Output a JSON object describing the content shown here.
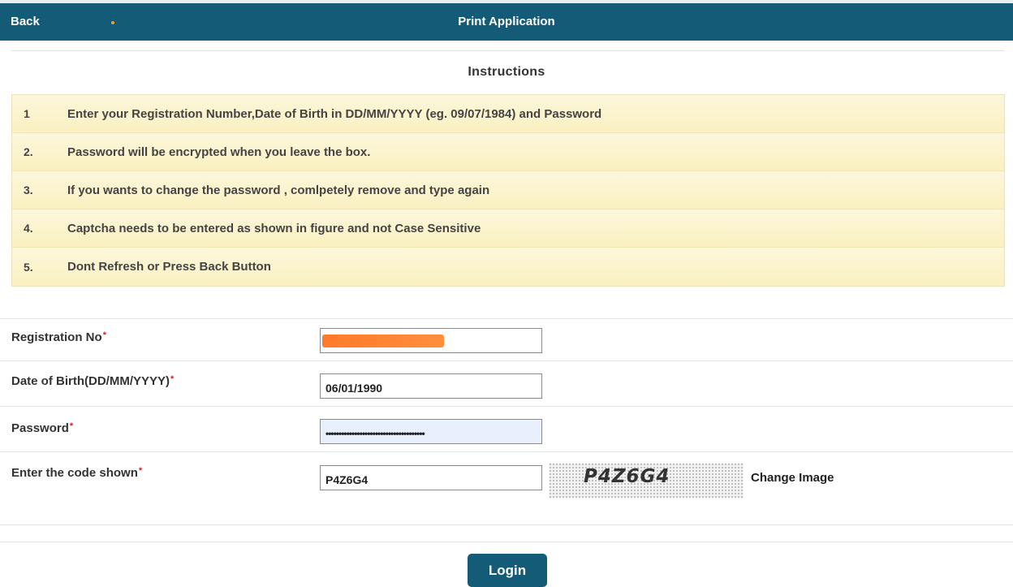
{
  "header": {
    "back_label": "Back",
    "title": "Print Application"
  },
  "instructions": {
    "title": "Instructions",
    "items": [
      {
        "num": "1",
        "text": "Enter your Registration Number,Date of Birth in DD/MM/YYYY (eg. 09/07/1984) and Password"
      },
      {
        "num": "2.",
        "text": "Password will be encrypted when you leave the box."
      },
      {
        "num": "3.",
        "text": "If you wants to change the password , comlpetely remove and type again"
      },
      {
        "num": "4.",
        "text": "Captcha needs to be entered as shown in figure and not Case Sensitive"
      },
      {
        "num": "5.",
        "text": "Dont Refresh or Press Back Button"
      }
    ]
  },
  "form": {
    "registration": {
      "label": "Registration No",
      "required_mark": "*",
      "value": ""
    },
    "dob": {
      "label": "Date of Birth(DD/MM/YYYY)",
      "required_mark": "*",
      "value": "06/01/1990"
    },
    "password": {
      "label": "Password",
      "required_mark": "*",
      "value": "••••••••••••••••••••••••••••••••••••••"
    },
    "captcha": {
      "label": "Enter the code shown",
      "required_mark": "*",
      "value": "P4Z6G4",
      "image_text": "P4Z6G4",
      "change_label": "Change Image"
    }
  },
  "login_label": "Login",
  "colors": {
    "header_bg": "#135b77",
    "instruction_bg": "#faf0c0",
    "required": "#d62020",
    "redaction": "#ff7a2c"
  }
}
